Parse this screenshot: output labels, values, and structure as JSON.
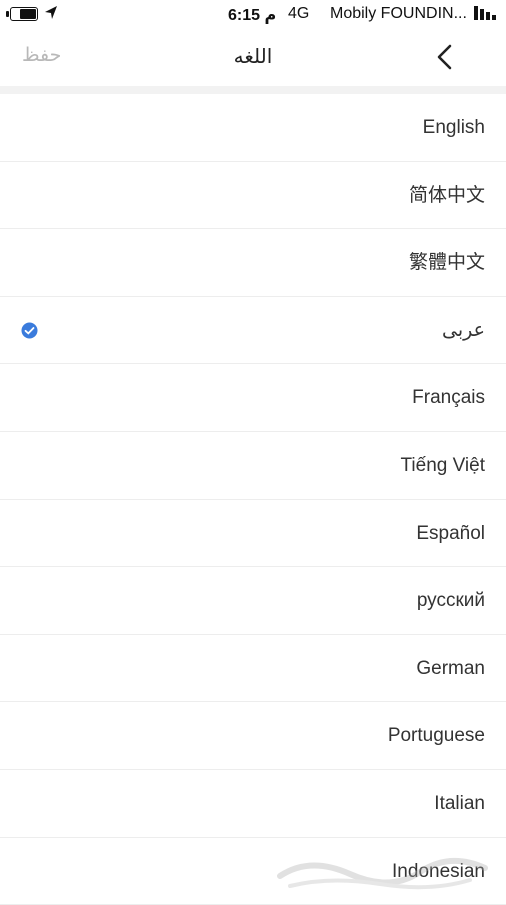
{
  "status_bar": {
    "time": "6:15 م",
    "network": "4G",
    "carrier": "Mobily FOUNDIN...",
    "icons": [
      "battery-icon",
      "location-arrow-icon",
      "signal-bars-icon"
    ]
  },
  "nav": {
    "save_label": "حفظ",
    "title": "اللغه",
    "back_icon": "chevron-left-icon"
  },
  "languages": {
    "selected_index": 3,
    "check_color": "#3a7bdc",
    "items": [
      {
        "label": "English"
      },
      {
        "label": "简体中文"
      },
      {
        "label": "繁體中文"
      },
      {
        "label": "عربى"
      },
      {
        "label": "Français"
      },
      {
        "label": "Tiếng Việt"
      },
      {
        "label": "Español"
      },
      {
        "label": "русский"
      },
      {
        "label": "German"
      },
      {
        "label": "Portuguese"
      },
      {
        "label": "Italian"
      },
      {
        "label": "Indonesian"
      }
    ]
  }
}
